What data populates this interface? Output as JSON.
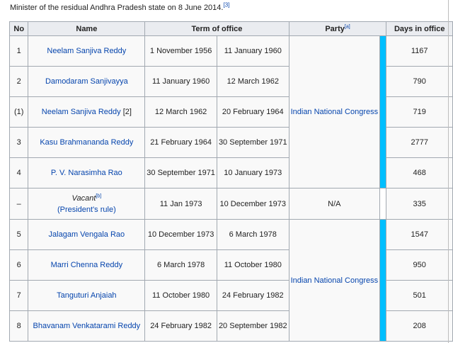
{
  "intro": {
    "text": "Minister of the residual Andhra Pradesh state on 8 June 2014.",
    "ref": "[3]"
  },
  "table": {
    "headers": {
      "no": "No",
      "name": "Name",
      "term": "Term of office",
      "party": "Party",
      "party_ref": "[a]",
      "days": "Days in office"
    },
    "rows": [
      {
        "no": "1",
        "name": "Neelam Sanjiva Reddy",
        "start": "1 November 1956",
        "end": "11 January 1960",
        "days": "1167"
      },
      {
        "no": "2",
        "name": "Damodaram Sanjivayya",
        "start": "11 January 1960",
        "end": "12 March 1962",
        "days": "790"
      },
      {
        "no": "(1)",
        "name": "Neelam Sanjiva Reddy",
        "name_suffix": " [2]",
        "start": "12 March 1962",
        "end": "20 February 1964",
        "days": "719"
      },
      {
        "no": "3",
        "name": "Kasu Brahmananda Reddy",
        "start": "21 February 1964",
        "end": "30 September 1971",
        "days": "2777"
      },
      {
        "no": "4",
        "name": "P. V. Narasimha Rao",
        "start": "30 September 1971",
        "end": "10 January 1973",
        "days": "468"
      },
      {
        "no": "–",
        "name": "Vacant",
        "name_ref": "[b]",
        "name_sub": "(President's rule)",
        "start": "11 Jan 1973",
        "end": "10 December 1973",
        "party": "N/A",
        "days": "335"
      },
      {
        "no": "5",
        "name": "Jalagam Vengala Rao",
        "start": "10 December 1973",
        "end": "6 March 1978",
        "days": "1547"
      },
      {
        "no": "6",
        "name": "Marri Chenna Reddy",
        "start": "6 March 1978",
        "end": "11 October 1980",
        "days": "950"
      },
      {
        "no": "7",
        "name": "Tanguturi Anjaiah",
        "start": "11 October 1980",
        "end": "24 February 1982",
        "days": "501"
      },
      {
        "no": "8",
        "name": "Bhavanam Venkatarami Reddy",
        "start": "24 February 1982",
        "end": "20 September 1982",
        "days": "208"
      }
    ],
    "party_groups": [
      {
        "label": "Indian National Congress",
        "color": "#00bfff"
      },
      {
        "label": "Indian National Congress",
        "color": "#00bfff"
      }
    ],
    "na_color": "#ffffff"
  }
}
